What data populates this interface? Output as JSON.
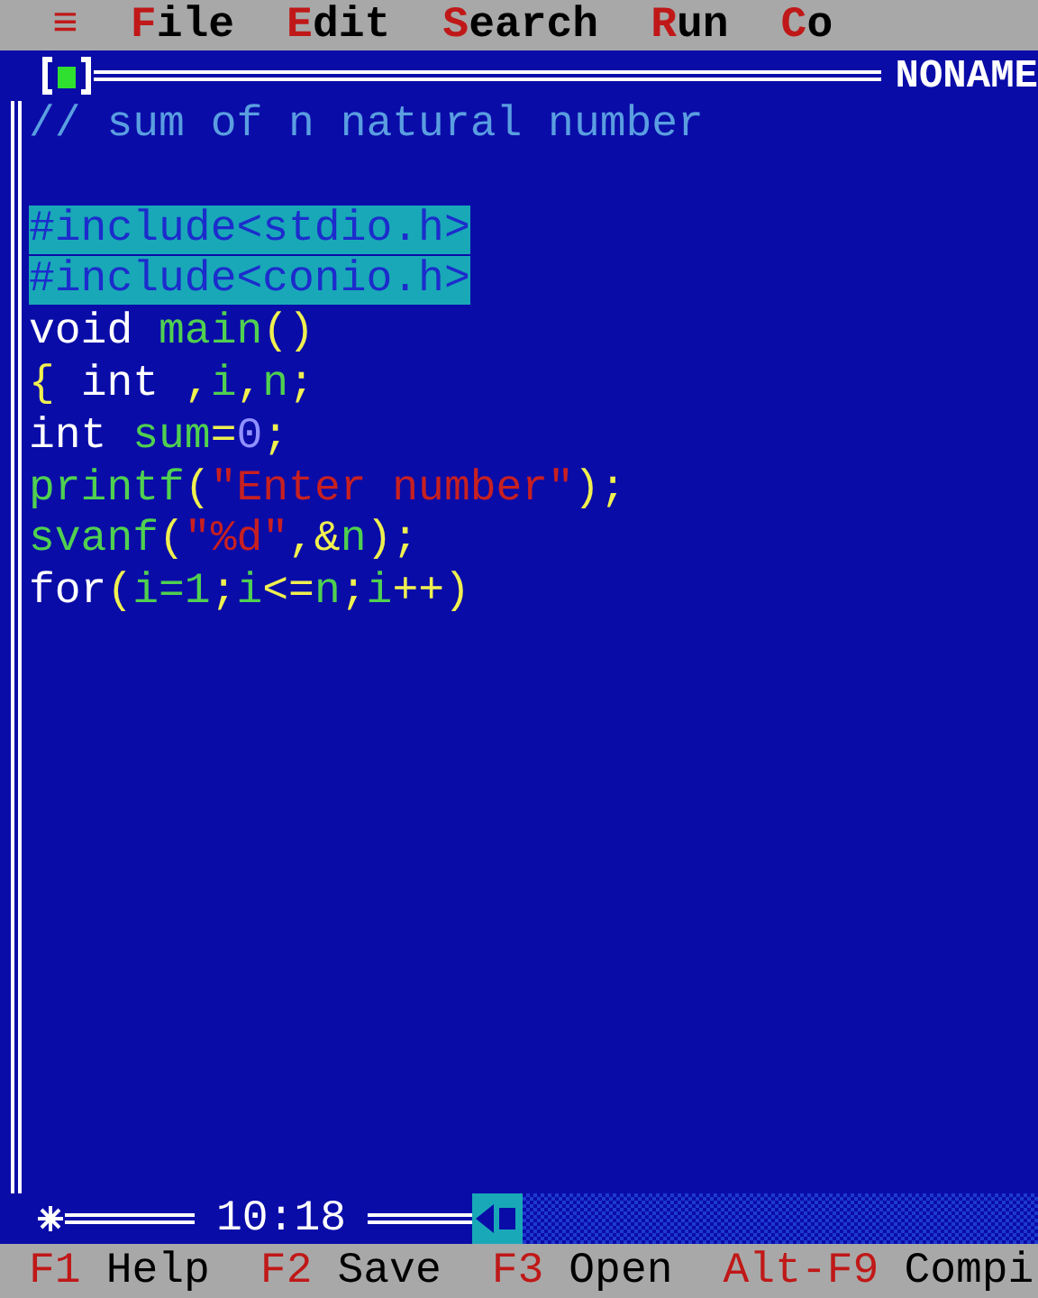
{
  "menu": [
    {
      "label": "≡"
    },
    {
      "label": "File"
    },
    {
      "label": "Edit"
    },
    {
      "label": "Search"
    },
    {
      "label": "Run"
    },
    {
      "label": "Co"
    }
  ],
  "window": {
    "title": "NONAME",
    "cursor_position": "10:18"
  },
  "lines": [
    {
      "selected": false,
      "tokens": [
        {
          "kind": "comment",
          "text": "// sum of n natural number"
        }
      ]
    },
    {
      "selected": false
    },
    {
      "selected": true,
      "tokens": [
        {
          "kind": "preproc",
          "text": "#include<stdio.h>"
        }
      ]
    },
    {
      "selected": true,
      "tokens": [
        {
          "kind": "preproc",
          "text": "#include<conio.h>"
        }
      ]
    },
    {
      "selected": false,
      "tokens": [
        {
          "kind": "keyword",
          "text": "void "
        },
        {
          "kind": "ident",
          "text": "main"
        },
        {
          "kind": "symbol",
          "text": "()"
        }
      ]
    },
    {
      "selected": false,
      "tokens": [
        {
          "kind": "symbol",
          "text": "{ "
        },
        {
          "kind": "keyword",
          "text": "int "
        },
        {
          "kind": "symbol",
          "text": ","
        },
        {
          "kind": "ident",
          "text": "i"
        },
        {
          "kind": "symbol",
          "text": ","
        },
        {
          "kind": "ident",
          "text": "n"
        },
        {
          "kind": "symbol",
          "text": ";"
        }
      ]
    },
    {
      "selected": false,
      "tokens": [
        {
          "kind": "keyword",
          "text": "int "
        },
        {
          "kind": "ident",
          "text": "sum"
        },
        {
          "kind": "symbol",
          "text": "="
        },
        {
          "kind": "number",
          "text": "0"
        },
        {
          "kind": "symbol",
          "text": ";"
        }
      ]
    },
    {
      "selected": false,
      "tokens": [
        {
          "kind": "ident",
          "text": "printf"
        },
        {
          "kind": "symbol",
          "text": "("
        },
        {
          "kind": "string",
          "text": "\"Enter number\""
        },
        {
          "kind": "symbol",
          "text": ");"
        }
      ]
    },
    {
      "selected": false,
      "tokens": [
        {
          "kind": "ident",
          "text": "svanf"
        },
        {
          "kind": "symbol",
          "text": "("
        },
        {
          "kind": "string",
          "text": "\"%d\""
        },
        {
          "kind": "symbol",
          "text": ",&"
        },
        {
          "kind": "ident",
          "text": "n"
        },
        {
          "kind": "symbol",
          "text": ");"
        }
      ]
    },
    {
      "selected": false,
      "tokens": [
        {
          "kind": "keyword",
          "text": "for"
        },
        {
          "kind": "symbol",
          "text": "("
        },
        {
          "kind": "ident",
          "text": "i=1"
        },
        {
          "kind": "symbol",
          "text": ";"
        },
        {
          "kind": "ident",
          "text": "i"
        },
        {
          "kind": "symbol",
          "text": "<="
        },
        {
          "kind": "ident",
          "text": "n"
        },
        {
          "kind": "symbol",
          "text": ";"
        },
        {
          "kind": "ident",
          "text": "i"
        },
        {
          "kind": "symbol",
          "text": "++)"
        }
      ]
    }
  ],
  "status_bar": [
    {
      "key": "F1",
      "label": "Help"
    },
    {
      "key": "F2",
      "label": "Save"
    },
    {
      "key": "F3",
      "label": "Open"
    },
    {
      "key": "Alt-F9",
      "label": "Compi"
    }
  ]
}
